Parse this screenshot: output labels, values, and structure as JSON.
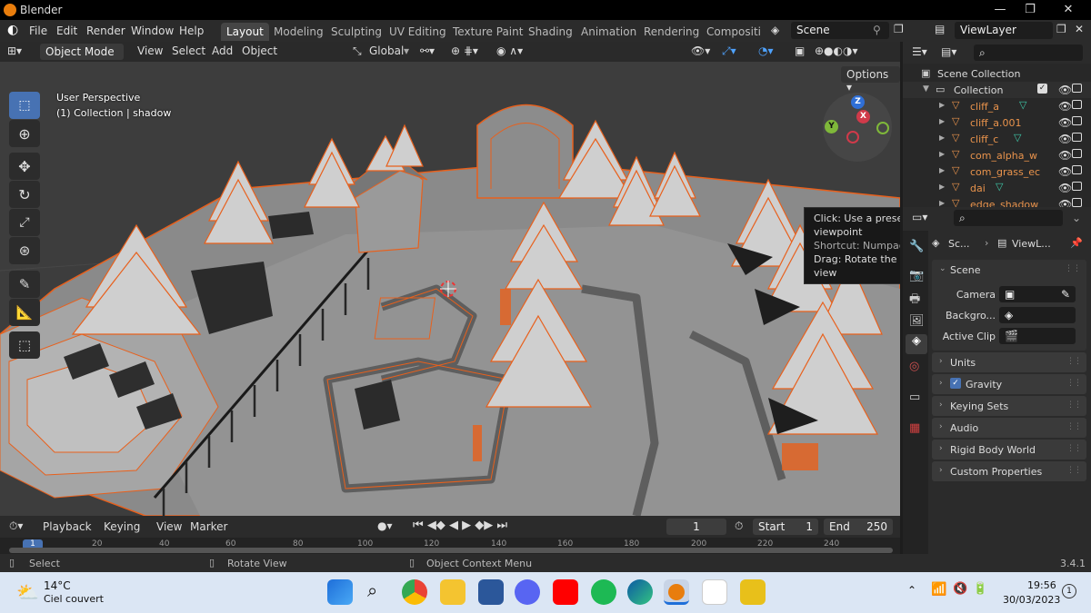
{
  "window": {
    "title": "Blender",
    "minimize": "—",
    "maximize": "❐",
    "close": "✕"
  },
  "menu": {
    "file": "File",
    "edit": "Edit",
    "render": "Render",
    "window": "Window",
    "help": "Help"
  },
  "workspaces": [
    "Layout",
    "Modeling",
    "Sculpting",
    "UV Editing",
    "Texture Paint",
    "Shading",
    "Animation",
    "Rendering",
    "Compositin"
  ],
  "scene_field": "Scene",
  "viewlayer_field": "ViewLayer",
  "viewport_header": {
    "mode": "Object Mode",
    "view": "View",
    "select": "Select",
    "add": "Add",
    "object": "Object",
    "transform": "Global",
    "options": "Options"
  },
  "viewport": {
    "perspective": "User Perspective",
    "collection_info": "(1) Collection | shadow",
    "gizmo": {
      "z": "Z",
      "x": "X",
      "y": "Y"
    },
    "tooltip": [
      "Click: Use a preset viewpoint",
      "Shortcut: Numpad 3",
      "Drag: Rotate the view"
    ]
  },
  "outliner": {
    "root": "Scene Collection",
    "collection": "Collection",
    "items": [
      "cliff_a",
      "cliff_a.001",
      "cliff_c",
      "com_alpha_w",
      "com_grass_ec",
      "dai",
      "edge_shadow"
    ]
  },
  "properties": {
    "breadcrumb_scene": "Sc...",
    "breadcrumb_view": "ViewL...",
    "scene_panel": "Scene",
    "camera_label": "Camera",
    "background_label": "Backgro...",
    "active_clip_label": "Active Clip",
    "panels": [
      "Units",
      "Gravity",
      "Keying Sets",
      "Audio",
      "Rigid Body World",
      "Custom Properties"
    ],
    "gravity_checked": true
  },
  "timeline": {
    "playback": "Playback",
    "keying": "Keying",
    "view": "View",
    "marker": "Marker",
    "current_frame": "1",
    "start_label": "Start",
    "start": "1",
    "end_label": "End",
    "end": "250",
    "ruler": [
      "1",
      "20",
      "40",
      "60",
      "80",
      "100",
      "120",
      "140",
      "160",
      "180",
      "200",
      "220",
      "240"
    ]
  },
  "statusbar": {
    "select": "Select",
    "rotate": "Rotate View",
    "context": "Object Context Menu",
    "version": "3.4.1"
  },
  "taskbar": {
    "temp": "14°C",
    "weather": "Ciel couvert",
    "time": "19:56",
    "date": "30/03/2023",
    "notifications": "1"
  },
  "colors": {
    "accent": "#4772b3",
    "selection_orange": "#e8601c",
    "blender_orange": "#e87d0d",
    "viewport_bg": "#3d3d3d"
  }
}
